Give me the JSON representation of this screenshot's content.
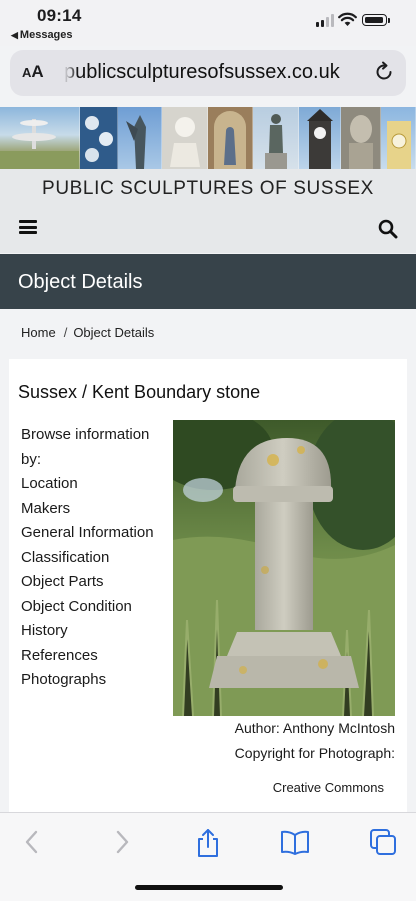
{
  "status_bar": {
    "time": "09:14",
    "back_app": "Messages"
  },
  "browser": {
    "text_size_label": "AA",
    "url": "publicsculpturesofsussex.co.uk"
  },
  "site": {
    "title": "PUBLIC SCULPTURES OF SUSSEX"
  },
  "page_header": {
    "title": "Object Details"
  },
  "breadcrumb": {
    "home": "Home",
    "separator": "/",
    "current": "Object Details"
  },
  "object": {
    "title": "Sussex / Kent Boundary stone",
    "browse_intro_line1": "Browse information",
    "browse_intro_line2": "by:",
    "links": [
      "Location",
      "Makers",
      "General Information",
      "Classification",
      "Object Parts",
      "Object Condition",
      "History",
      "References",
      "Photographs"
    ],
    "photo_author": "Author: Anthony McIntosh",
    "photo_copyright": "Copyright for Photograph:",
    "photo_license": "Creative Commons"
  },
  "icons": {
    "toolbar": [
      "back-icon",
      "forward-icon",
      "share-icon",
      "bookmarks-icon",
      "tabs-icon"
    ],
    "site_nav": [
      "menu-icon",
      "search-icon"
    ]
  },
  "colors": {
    "accent": "#2f6fde",
    "header_bar": "#37434a",
    "disabled": "#b8b8bd"
  }
}
